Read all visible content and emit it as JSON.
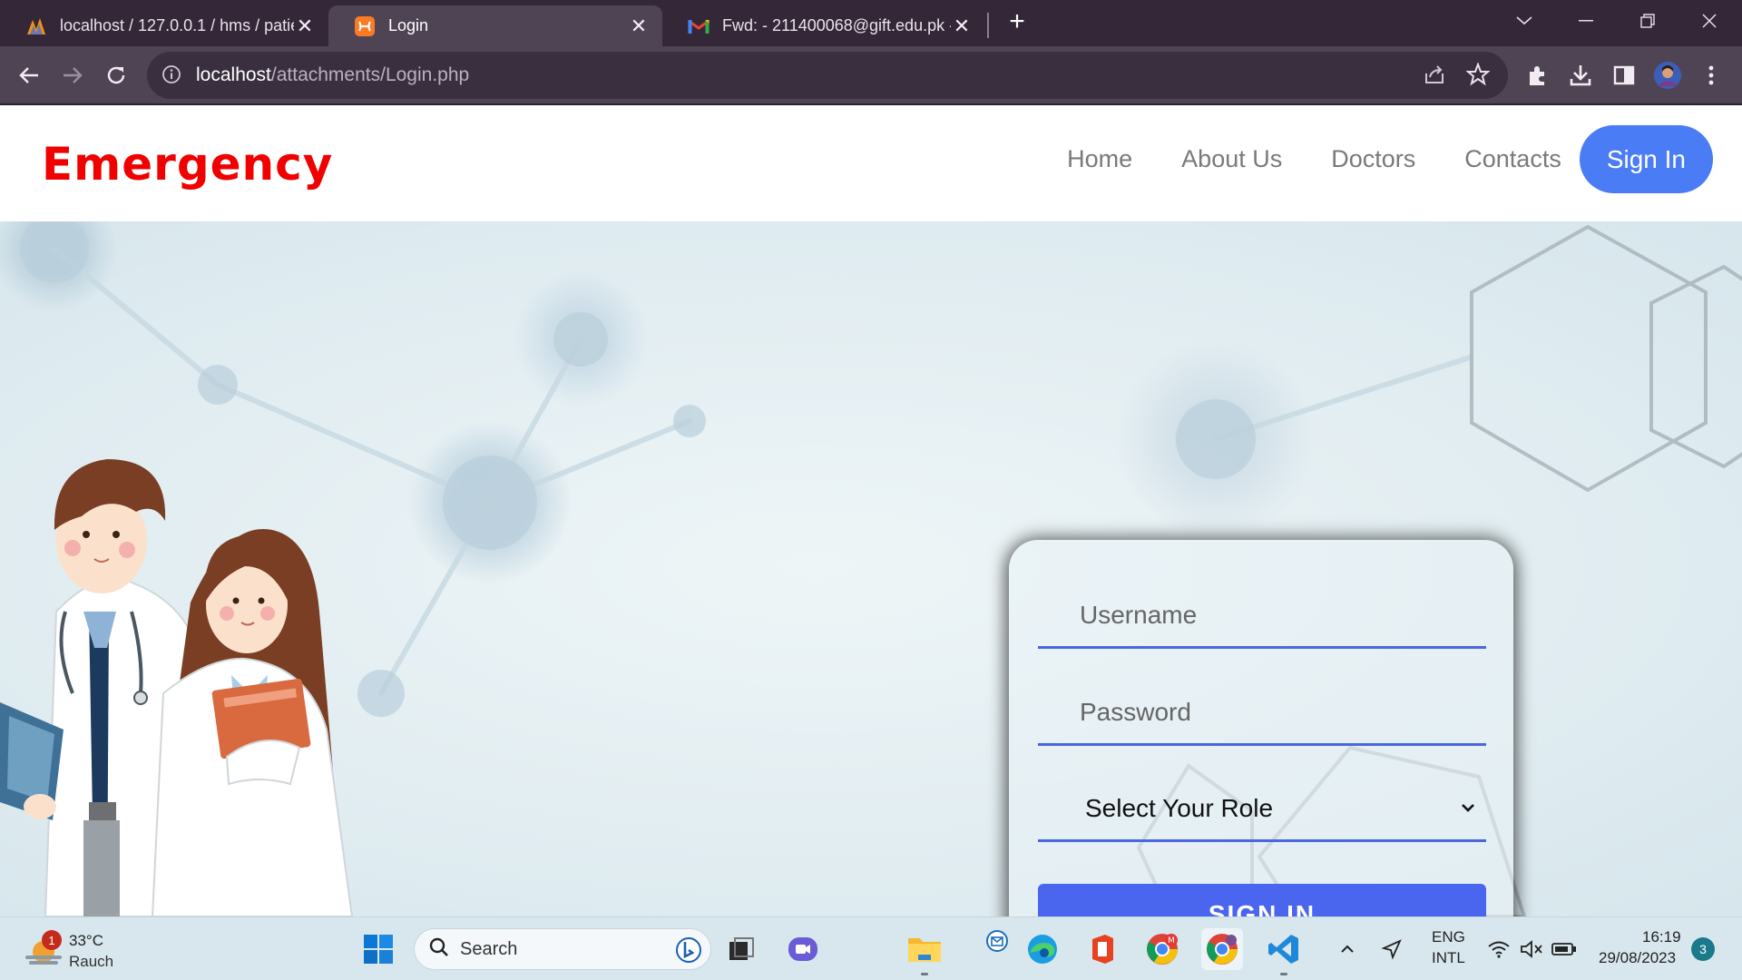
{
  "browser": {
    "tabs": [
      {
        "title": "localhost / 127.0.0.1 / hms / patie",
        "active": false
      },
      {
        "title": "Login",
        "active": true
      },
      {
        "title": "Fwd: - 211400068@gift.edu.pk - ",
        "active": false
      }
    ],
    "url_host": "localhost",
    "url_path": "/attachments/Login.php"
  },
  "site": {
    "brand": "Emergency",
    "nav": [
      "Home",
      "About Us",
      "Doctors",
      "Contacts"
    ],
    "signin_nav": "Sign In"
  },
  "login": {
    "username_placeholder": "Username",
    "password_placeholder": "Password",
    "role_value": "Select Your Role",
    "submit_label": "SIGN IN"
  },
  "taskbar": {
    "weather_temp": "33°C",
    "weather_cond": "Rauch",
    "weather_badge": "1",
    "search_label": "Search",
    "lang_line1": "ENG",
    "lang_line2": "INTL",
    "time": "16:19",
    "date": "29/08/2023",
    "notifications": "3"
  },
  "colors": {
    "brand": "#f00000",
    "primary": "#4a66ef",
    "nav_pill": "#4a7cf5"
  }
}
